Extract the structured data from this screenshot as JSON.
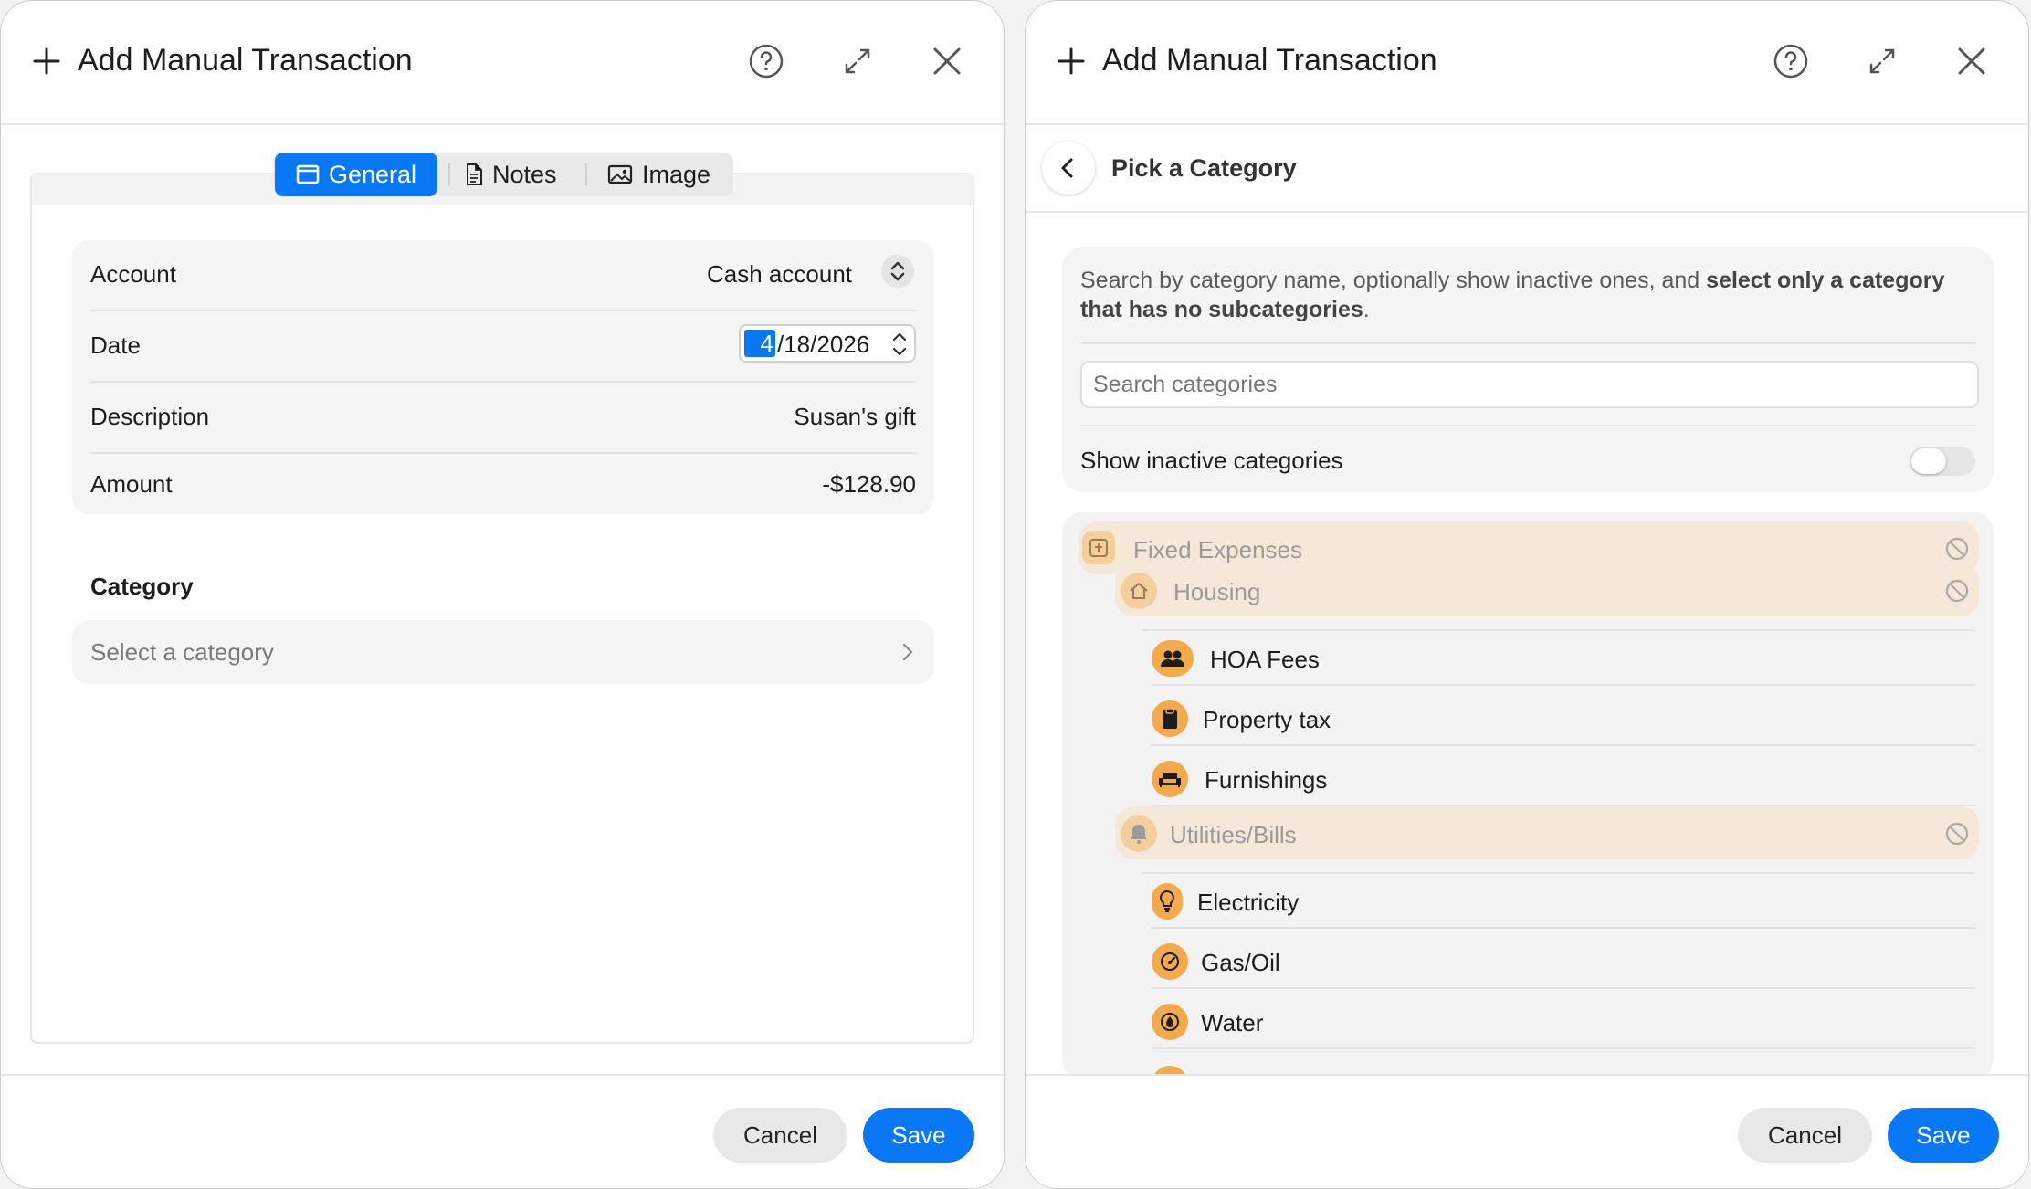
{
  "left_window": {
    "title": "Add Manual Transaction",
    "tabs": [
      {
        "label": "General",
        "icon": "window-icon",
        "active": true
      },
      {
        "label": "Notes",
        "icon": "document-icon",
        "active": false
      },
      {
        "label": "Image",
        "icon": "photo-icon",
        "active": false
      }
    ],
    "form": {
      "account": {
        "label": "Account",
        "value": "Cash account"
      },
      "date": {
        "label": "Date",
        "month": "4",
        "rest": "/18/2026"
      },
      "description": {
        "label": "Description",
        "value": "Susan's gift"
      },
      "amount": {
        "label": "Amount",
        "value": "-$128.90"
      }
    },
    "category": {
      "heading": "Category",
      "placeholder": "Select a category"
    },
    "footer": {
      "cancel": "Cancel",
      "save": "Save"
    }
  },
  "right_window": {
    "title": "Add Manual Transaction",
    "subheader": "Pick a Category",
    "description_plain": "Search by category name, optionally show inactive ones, and",
    "description_bold": "select only a category that has no subcategories",
    "description_end": ".",
    "search_placeholder": "Search categories",
    "toggle_label": "Show inactive categories",
    "toggle_on": false,
    "categories": [
      {
        "name": "Fixed Expenses",
        "level": 0,
        "group": true,
        "icon": "pin-icon"
      },
      {
        "name": "Housing",
        "level": 1,
        "group": true,
        "icon": "house-icon"
      },
      {
        "name": "HOA Fees",
        "level": 2,
        "group": false,
        "icon": "people-icon"
      },
      {
        "name": "Property tax",
        "level": 2,
        "group": false,
        "icon": "clipboard-icon"
      },
      {
        "name": "Furnishings",
        "level": 2,
        "group": false,
        "icon": "sofa-icon"
      },
      {
        "name": "Utilities/Bills",
        "level": 1,
        "group": true,
        "icon": "bell-icon"
      },
      {
        "name": "Electricity",
        "level": 2,
        "group": false,
        "icon": "lightbulb-icon"
      },
      {
        "name": "Gas/Oil",
        "level": 2,
        "group": false,
        "icon": "gauge-icon"
      },
      {
        "name": "Water",
        "level": 2,
        "group": false,
        "icon": "water-drop-icon"
      }
    ],
    "footer": {
      "cancel": "Cancel",
      "save": "Save"
    }
  },
  "colors": {
    "accent": "#0a78f5",
    "category_icon": "#f3a94e",
    "group_bg": "#f5e8d9"
  }
}
